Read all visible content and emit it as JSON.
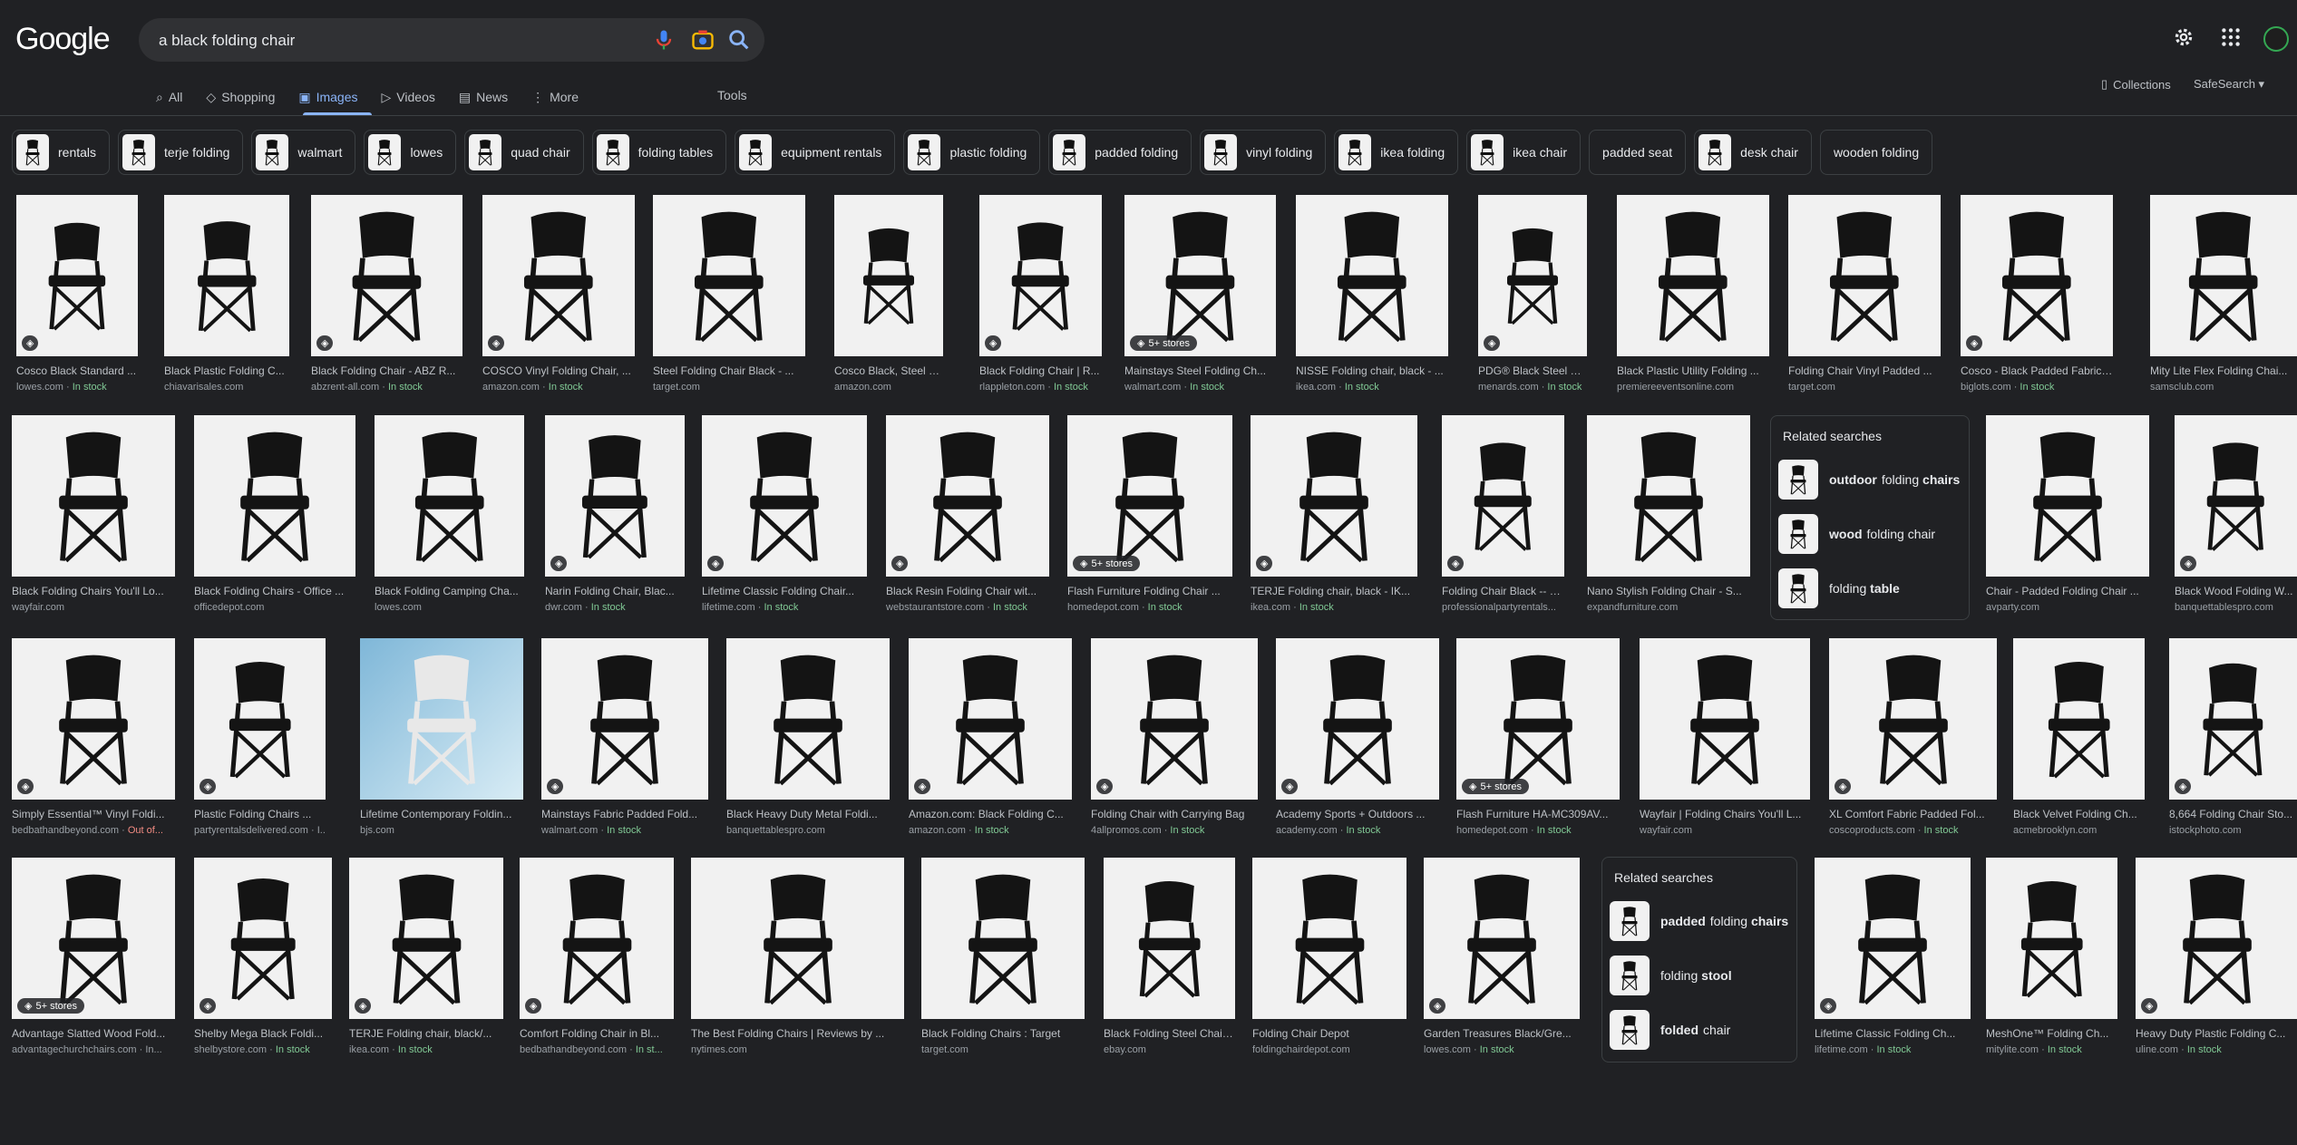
{
  "logo": "Google",
  "search": {
    "query": "a black folding chair"
  },
  "tabs": [
    {
      "label": "All",
      "icon": "search-icon"
    },
    {
      "label": "Shopping",
      "icon": "tag-icon"
    },
    {
      "label": "Images",
      "icon": "image-icon",
      "active": true
    },
    {
      "label": "Videos",
      "icon": "play-icon"
    },
    {
      "label": "News",
      "icon": "news-icon"
    },
    {
      "label": "More",
      "icon": "more-vert-icon"
    }
  ],
  "tools_label": "Tools",
  "collections_label": "Collections",
  "safesearch_label": "SafeSearch",
  "chips": [
    "rentals",
    "terje folding",
    "walmart",
    "lowes",
    "quad chair",
    "folding tables",
    "equipment rentals",
    "plastic folding",
    "padded folding",
    "vinyl folding",
    "ikea folding",
    "ikea chair",
    "padded seat",
    "desk chair",
    "wooden folding"
  ],
  "results": [
    {
      "title": "Cosco Black Standard ...",
      "source": "lowes.com",
      "stock": "In stock",
      "badge": "tag"
    },
    {
      "title": "Black Plastic Folding C...",
      "source": "chiavarisales.com"
    },
    {
      "title": "Black Folding Chair - ABZ R...",
      "source": "abzrent-all.com",
      "stock": "In stock",
      "badge": "tag"
    },
    {
      "title": "COSCO Vinyl Folding Chair, ...",
      "source": "amazon.com",
      "stock": "In stock",
      "badge": "tag"
    },
    {
      "title": "Steel Folding Chair Black - ...",
      "source": "target.com"
    },
    {
      "title": "Cosco Black, Steel Fold...",
      "source": "amazon.com"
    },
    {
      "title": "Black Folding Chair | R...",
      "source": "rlappleton.com",
      "stock": "In stock",
      "badge": "tag"
    },
    {
      "title": "Mainstays Steel Folding Ch...",
      "source": "walmart.com",
      "stock": "In stock",
      "badge": "5+ stores"
    },
    {
      "title": "NISSE Folding chair, black - ...",
      "source": "ikea.com",
      "stock": "In stock"
    },
    {
      "title": "PDG® Black Steel Foldi...",
      "source": "menards.com",
      "stock": "In stock",
      "badge": "tag"
    },
    {
      "title": "Black Plastic Utility Folding ...",
      "source": "premiereeventsonline.com"
    },
    {
      "title": "Folding Chair Vinyl Padded ...",
      "source": "target.com"
    },
    {
      "title": "Cosco - Black Padded Fabric Fo...",
      "source": "biglots.com",
      "stock": "In stock",
      "badge": "tag"
    },
    {
      "title": "Mity Lite Flex Folding Chai...",
      "source": "samsclub.com"
    },
    {
      "title": "Black Folding Chairs You'll Lo...",
      "source": "wayfair.com"
    },
    {
      "title": "Black Folding Chairs - Office ...",
      "source": "officedepot.com"
    },
    {
      "title": "Black Folding Camping Cha...",
      "source": "lowes.com"
    },
    {
      "title": "Narin Folding Chair, Blac...",
      "source": "dwr.com",
      "stock": "In stock",
      "badge": "tag"
    },
    {
      "title": "Lifetime Classic Folding Chair...",
      "source": "lifetime.com",
      "stock": "In stock",
      "badge": "tag"
    },
    {
      "title": "Black Resin Folding Chair wit...",
      "source": "webstaurantstore.com",
      "stock": "In stock",
      "badge": "tag"
    },
    {
      "title": "Flash Furniture Folding Chair ...",
      "source": "homedepot.com",
      "stock": "In stock",
      "badge": "5+ stores"
    },
    {
      "title": "TERJE Folding chair, black - IK...",
      "source": "ikea.com",
      "stock": "In stock",
      "badge": "tag"
    },
    {
      "title": "Folding Chair Black -- P...",
      "source": "professionalpartyrentals...",
      "badge": "tag"
    },
    {
      "title": "Nano Stylish Folding Chair - S...",
      "source": "expandfurniture.com"
    },
    {
      "title": "Chair - Padded Folding Chair ...",
      "source": "avparty.com"
    },
    {
      "title": "Black Wood Folding W...",
      "source": "banquettablespro.com",
      "badge": "tag"
    },
    {
      "title": "Simply Essential™ Vinyl Foldi...",
      "source": "bedbathandbeyond.com",
      "out": "Out of...",
      "badge": "tag"
    },
    {
      "title": "Plastic Folding Chairs ...",
      "source": "partyrentalsdelivered.com · I...",
      "badge": "tag"
    },
    {
      "title": "Lifetime Contemporary Foldin...",
      "source": "bjs.com"
    },
    {
      "title": "Mainstays Fabric Padded Fold...",
      "source": "walmart.com",
      "stock": "In stock",
      "badge": "tag"
    },
    {
      "title": "Black Heavy Duty Metal Foldi...",
      "source": "banquettablespro.com"
    },
    {
      "title": "Amazon.com: Black Folding C...",
      "source": "amazon.com",
      "stock": "In stock",
      "badge": "tag"
    },
    {
      "title": "Folding Chair with Carrying Bag",
      "source": "4allpromos.com",
      "stock": "In stock",
      "badge": "tag"
    },
    {
      "title": "Academy Sports + Outdoors ...",
      "source": "academy.com",
      "stock": "In stock",
      "badge": "tag"
    },
    {
      "title": "Flash Furniture HA-MC309AV...",
      "source": "homedepot.com",
      "stock": "In stock",
      "badge": "5+ stores"
    },
    {
      "title": "Wayfair | Folding Chairs You'll L...",
      "source": "wayfair.com"
    },
    {
      "title": "XL Comfort Fabric Padded Fol...",
      "source": "coscoproducts.com",
      "stock": "In stock",
      "badge": "tag"
    },
    {
      "title": "Black Velvet Folding Ch...",
      "source": "acmebrooklyn.com"
    },
    {
      "title": "8,664 Folding Chair Sto...",
      "source": "istockphoto.com",
      "badge": "tag"
    },
    {
      "title": "Advantage Slatted Wood Fold...",
      "source": "advantagechurchchairs.com · In...",
      "badge": "5+ stores"
    },
    {
      "title": "Shelby Mega Black Foldi...",
      "source": "shelbystore.com",
      "stock": "In stock",
      "badge": "tag"
    },
    {
      "title": "TERJE Folding chair, black/...",
      "source": "ikea.com",
      "stock": "In stock",
      "badge": "tag"
    },
    {
      "title": "Comfort Folding Chair in Bl...",
      "source": "bedbathandbeyond.com",
      "stock": "In st...",
      "badge": "tag"
    },
    {
      "title": "The Best Folding Chairs | Reviews by ...",
      "source": "nytimes.com"
    },
    {
      "title": "Black Folding Chairs : Target",
      "source": "target.com"
    },
    {
      "title": "Black Folding Steel Chairs fo...",
      "source": "ebay.com"
    },
    {
      "title": "Folding Chair Depot",
      "source": "foldingchairdepot.com"
    },
    {
      "title": "Garden Treasures Black/Gre...",
      "source": "lowes.com",
      "stock": "In stock",
      "badge": "tag"
    },
    {
      "title": "Lifetime Classic Folding Ch...",
      "source": "lifetime.com",
      "stock": "In stock",
      "badge": "tag"
    },
    {
      "title": "MeshOne™ Folding Ch...",
      "source": "mitylite.com",
      "stock": "In stock"
    },
    {
      "title": "Heavy Duty Plastic Folding C...",
      "source": "uline.com",
      "stock": "In stock",
      "badge": "tag"
    }
  ],
  "related_1": {
    "heading": "Related searches",
    "items": [
      {
        "bold": "outdoor",
        "rest": "folding",
        "bold2": "chairs"
      },
      {
        "bold": "wood",
        "rest": "folding chair",
        "bold2": ""
      },
      {
        "bold": "",
        "rest": "folding",
        "bold2": "table"
      }
    ]
  },
  "related_2": {
    "heading": "Related searches",
    "items": [
      {
        "bold": "padded",
        "rest": "folding",
        "bold2": "chairs"
      },
      {
        "bold": "",
        "rest": "folding",
        "bold2": "stool"
      },
      {
        "bold": "folded",
        "rest": "chair",
        "bold2": ""
      }
    ]
  }
}
